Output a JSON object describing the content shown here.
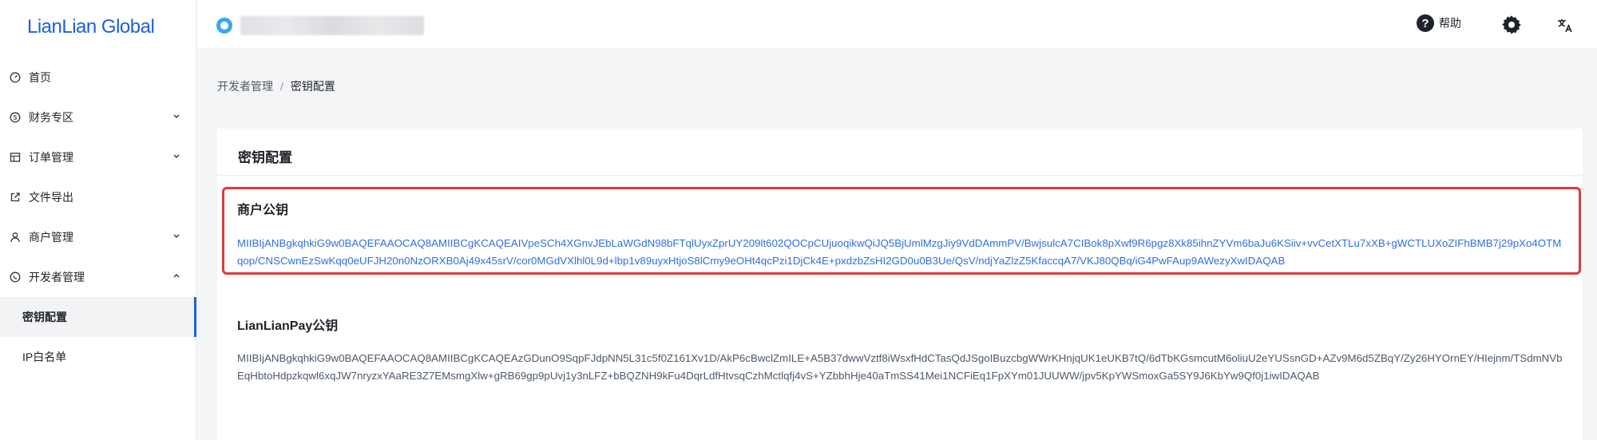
{
  "app": {
    "logo": "LianLian Global"
  },
  "sidebar": {
    "items": [
      {
        "label": "首页",
        "icon": "dashboard-icon",
        "expandable": false
      },
      {
        "label": "财务专区",
        "icon": "dollar-circle-icon",
        "expandable": true,
        "expanded": false
      },
      {
        "label": "订单管理",
        "icon": "table-icon",
        "expandable": true,
        "expanded": false
      },
      {
        "label": "文件导出",
        "icon": "export-icon",
        "expandable": false
      },
      {
        "label": "商户管理",
        "icon": "user-icon",
        "expandable": true,
        "expanded": false
      },
      {
        "label": "开发者管理",
        "icon": "developer-icon",
        "expandable": true,
        "expanded": true
      },
      {
        "label": "密钥配置",
        "sub": true,
        "active": true
      },
      {
        "label": "IP白名单",
        "sub": true,
        "active": false
      }
    ]
  },
  "header": {
    "store_name": "",
    "help_label": "帮助",
    "accent_color": "#1c5fe0"
  },
  "breadcrumb": {
    "parent": "开发者管理",
    "separator": "/",
    "current": "密钥配置"
  },
  "card": {
    "title": "密钥配置",
    "merchant_key": {
      "title": "商户公钥",
      "value": "MIIBIjANBgkqhkiG9w0BAQEFAAOCAQ8AMIIBCgKCAQEAIVpeSCh4XGnvJEbLaWGdN98bFTqlUyxZprUY209lt602QOCpCUjuoqikwQiJQ5BjUmlMzgJiy9VdDAmmPV/BwjsulcA7CIBok8pXwf9R6pgz8Xk85ihnZYVm6baJu6KSiiv+vvCetXTLu7xXB+gWCTLUXoZIFhBMB7j29pXo4OTMqop/CNSCwnEzSwKqq0eUFJH20n0NzORXB0Aj49x45srV/cor0MGdVXlhl0L9d+lbp1v89uyxHtjoS8lCmy9eOHt4qcPzi1DjCk4E+pxdzbZsHI2GD0u0B3Ue/QsV/ndjYaZlzZ5KfaccqA7/VKJ80QBq/iG4PwFAup9AWezyXwIDAQAB",
      "color": "#2f6fe4",
      "highlight_color": "#e0393a"
    },
    "lianlian_key": {
      "title": "LianLianPay公钥",
      "value": "MIIBIjANBgkqhkiG9w0BAQEFAAOCAQ8AMIIBCgKCAQEAzGDunO9SqpFJdpNN5L31c5f0Z161Xv1D/AkP6cBwclZmILE+A5B37dwwVztf8iWsxfHdCTasQdJSgoIBuzcbgWWrKHnjqUK1eUKB7tQ/6dTbKGsmcutM6oliuU2eYUSsnGD+AZv9M6d5ZBqY/Zy26HYOrnEY/HIejnm/TSdmNVbEqHbtoHdpzkqwl6xqJW7nryzxYAaRE3Z7EMsmgXlw+gRB69gp9pUvj1y3nLFZ+bBQZNH9kFu4DqrLdfHtvsqCzhMctlqfj4vS+YZbbhHje40aTmSS41Mei1NCFiEq1FpXYm01JUUWW/jpv5KpYWSmoxGa5SY9J6KbYw9Qf0j1iwIDAQAB",
      "color": "#4e5969"
    }
  }
}
